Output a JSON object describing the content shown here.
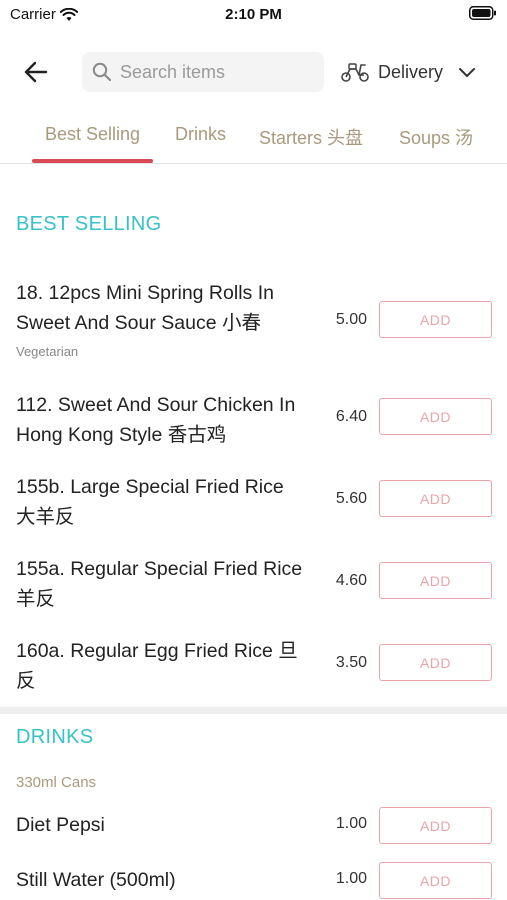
{
  "status_bar": {
    "carrier": "Carrier",
    "time": "2:10 PM"
  },
  "header": {
    "search_placeholder": "Search items",
    "delivery_label": "Delivery"
  },
  "tabs": [
    {
      "label": "Best Selling",
      "active": true
    },
    {
      "label": "Drinks",
      "active": false
    },
    {
      "label": "Starters 头盘",
      "active": false
    },
    {
      "label": "Soups 汤",
      "active": false
    }
  ],
  "best_selling": {
    "title": "BEST SELLING",
    "items": [
      {
        "name": "18. 12pcs Mini Spring Rolls In Sweet And Sour Sauce 小春",
        "tag": "Vegetarian",
        "price": "5.00",
        "button": "ADD"
      },
      {
        "name": "112. Sweet And Sour Chicken In Hong Kong Style 香古鸡",
        "price": "6.40",
        "button": "ADD"
      },
      {
        "name": "155b. Large Special Fried Rice 大羊反",
        "price": "5.60",
        "button": "ADD"
      },
      {
        "name": "155a. Regular Special Fried Rice 羊反",
        "price": "4.60",
        "button": "ADD"
      },
      {
        "name": "160a. Regular Egg Fried Rice 旦反",
        "price": "3.50",
        "button": "ADD"
      }
    ]
  },
  "drinks": {
    "title": "DRINKS",
    "subheading": "330ml Cans",
    "items": [
      {
        "name": "Diet Pepsi",
        "price": "1.00",
        "button": "ADD"
      },
      {
        "name": "Still Water (500ml)",
        "price": "1.00",
        "button": "ADD"
      }
    ]
  },
  "colors": {
    "accent_teal": "#35c2c8",
    "accent_red": "#d94a54",
    "tab_text": "#a99a7d",
    "add_button": "#e9a5aa"
  }
}
